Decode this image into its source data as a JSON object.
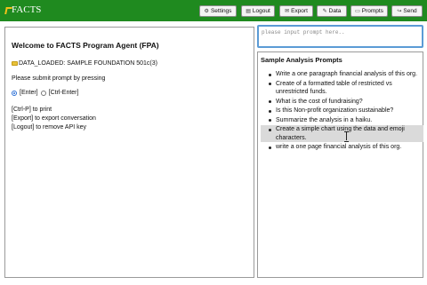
{
  "app": {
    "logo_text": "FACTS",
    "logo_icon": "facts-logo-icon"
  },
  "toolbar": {
    "settings": {
      "label": "Settings",
      "icon": "gear-icon"
    },
    "logout": {
      "label": "Logout",
      "icon": "logout-icon"
    },
    "export": {
      "label": "Export",
      "icon": "export-icon"
    },
    "data": {
      "label": "Data",
      "icon": "data-icon"
    },
    "prompts": {
      "label": "Prompts",
      "icon": "prompts-icon"
    },
    "send": {
      "label": "Send",
      "icon": "send-icon"
    }
  },
  "left_panel": {
    "welcome": "Welcome to FACTS Program Agent (FPA)",
    "data_loaded": "DATA_LOADED: SAMPLE FOUNDATION 501c(3)",
    "submit_instruction": "Please submit prompt by pressing",
    "radio_enter": "[Enter]",
    "radio_ctrl_enter": "[Ctrl-Enter]",
    "selected_radio": "[Enter]",
    "shortcuts": [
      "[Ctrl-P] to print",
      "[Export] to export conversation",
      "[Logout] to remove API key"
    ]
  },
  "prompt_input": {
    "placeholder": "please input prompt here..",
    "value": ""
  },
  "sample_prompts": {
    "title": "Sample Analysis Prompts",
    "items": [
      "Write a one paragraph financial analysis of this org.",
      "Create of a formatted table of restricted vs unrestricted funds.",
      "What is the cost of fundraising?",
      "Is this Non-profit organization sustainable?",
      "Summarize the analysis in a haiku.",
      "Create a simple chart using the data and emoji characters.",
      "write a one page financial analysis of this org."
    ],
    "highlighted_index": 5
  },
  "colors": {
    "topbar": "#1f8a1f",
    "accent": "#5b9bd5",
    "highlight": "#dadada"
  }
}
